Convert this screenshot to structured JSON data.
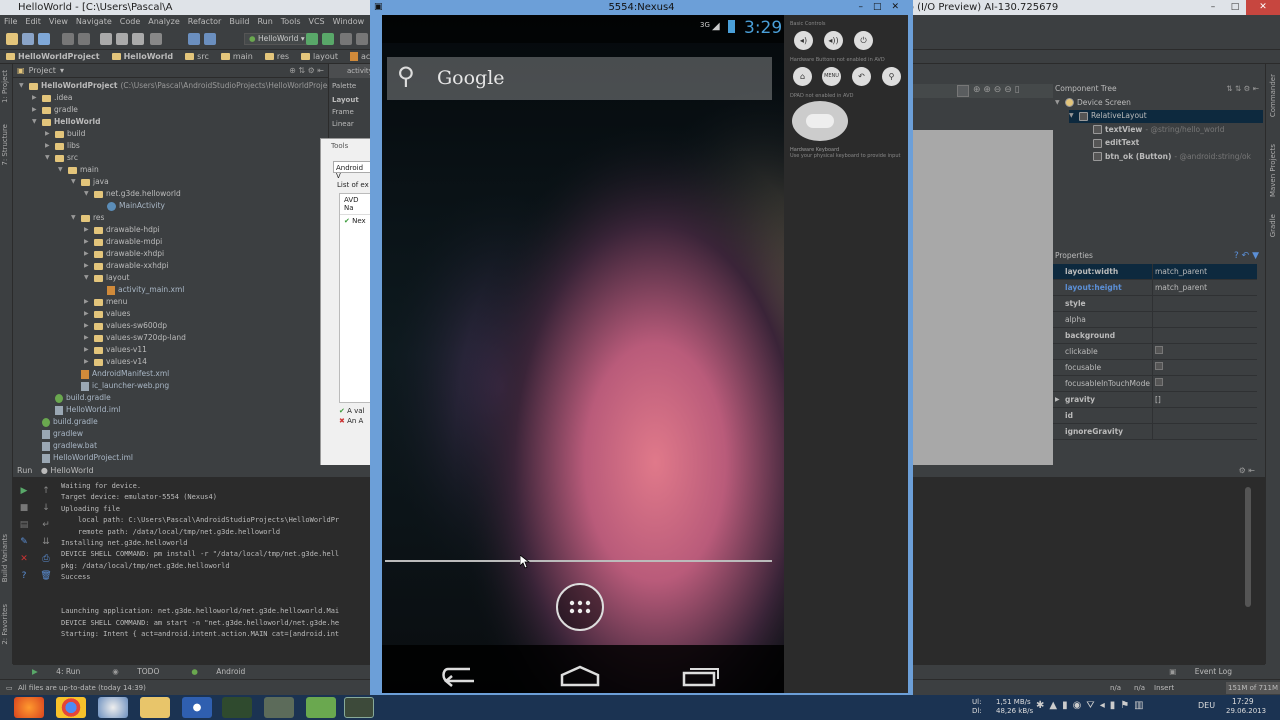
{
  "ide": {
    "title": "HelloWorld - [C:\\Users\\Pascal\\A",
    "title_right": "io (I/O Preview) AI-130.725679",
    "menu": [
      "File",
      "Edit",
      "View",
      "Navigate",
      "Code",
      "Analyze",
      "Refactor",
      "Build",
      "Run",
      "Tools",
      "VCS",
      "Window",
      "Help"
    ],
    "run_config": "HelloWorld",
    "breadcrumbs": [
      "HelloWorldProject",
      "HelloWorld",
      "src",
      "main",
      "res",
      "layout",
      "activity_main.xml"
    ],
    "editor_tab": "activity"
  },
  "project_panel": {
    "header": "Project",
    "tree": [
      {
        "label": "HelloWorldProject",
        "suffix": "(C:\\Users\\Pascal\\AndroidStudioProjects\\HelloWorldProject)",
        "depth": 0,
        "type": "folder",
        "open": true
      },
      {
        "label": ".idea",
        "depth": 1,
        "type": "folder"
      },
      {
        "label": "gradle",
        "depth": 1,
        "type": "folder"
      },
      {
        "label": "HelloWorld",
        "depth": 1,
        "type": "folder",
        "open": true
      },
      {
        "label": "build",
        "depth": 2,
        "type": "folder"
      },
      {
        "label": "libs",
        "depth": 2,
        "type": "folder"
      },
      {
        "label": "src",
        "depth": 2,
        "type": "folder",
        "open": true
      },
      {
        "label": "main",
        "depth": 3,
        "type": "folder",
        "open": true
      },
      {
        "label": "java",
        "depth": 4,
        "type": "folder",
        "open": true
      },
      {
        "label": "net.g3de.helloworld",
        "depth": 5,
        "type": "folder",
        "open": true
      },
      {
        "label": "MainActivity",
        "depth": 6,
        "type": "java"
      },
      {
        "label": "res",
        "depth": 4,
        "type": "folder",
        "open": true
      },
      {
        "label": "drawable-hdpi",
        "depth": 5,
        "type": "folder"
      },
      {
        "label": "drawable-mdpi",
        "depth": 5,
        "type": "folder"
      },
      {
        "label": "drawable-xhdpi",
        "depth": 5,
        "type": "folder"
      },
      {
        "label": "drawable-xxhdpi",
        "depth": 5,
        "type": "folder"
      },
      {
        "label": "layout",
        "depth": 5,
        "type": "folder",
        "open": true
      },
      {
        "label": "activity_main.xml",
        "depth": 6,
        "type": "xml"
      },
      {
        "label": "menu",
        "depth": 5,
        "type": "folder"
      },
      {
        "label": "values",
        "depth": 5,
        "type": "folder"
      },
      {
        "label": "values-sw600dp",
        "depth": 5,
        "type": "folder"
      },
      {
        "label": "values-sw720dp-land",
        "depth": 5,
        "type": "folder"
      },
      {
        "label": "values-v11",
        "depth": 5,
        "type": "folder"
      },
      {
        "label": "values-v14",
        "depth": 5,
        "type": "folder"
      },
      {
        "label": "AndroidManifest.xml",
        "depth": 4,
        "type": "xml"
      },
      {
        "label": "ic_launcher-web.png",
        "depth": 4,
        "type": "file"
      },
      {
        "label": "build.gradle",
        "depth": 2,
        "type": "gradle"
      },
      {
        "label": "HelloWorld.iml",
        "depth": 2,
        "type": "file"
      },
      {
        "label": "build.gradle",
        "depth": 1,
        "type": "gradle"
      },
      {
        "label": "gradlew",
        "depth": 1,
        "type": "file"
      },
      {
        "label": "gradlew.bat",
        "depth": 1,
        "type": "file"
      },
      {
        "label": "HelloWorldProject.iml",
        "depth": 1,
        "type": "file"
      }
    ]
  },
  "palette": {
    "header": "Palette",
    "items": [
      "Layout",
      "Frame",
      "Linear"
    ]
  },
  "avd_dialog": {
    "tools": "Tools",
    "tab": "Android V",
    "list_label": "List of ex",
    "col": "AVD Na",
    "row": "Nex",
    "msg1": "A val",
    "msg2": "An A"
  },
  "emulator": {
    "title": "5554:Nexus4",
    "network": "3G",
    "time": "3:29",
    "search_text": "Google",
    "controls": {
      "basic": "Basic Controls",
      "hardware": "Hardware Buttons",
      "hardware_note": "not enabled in AVD",
      "dpad": "DPAD",
      "dpad_note": "not enabled in AVD",
      "keyboard": "Hardware Keyboard",
      "keyboard_note": "Use your physical keyboard to provide input",
      "menu_label": "MENU"
    }
  },
  "component_tree": {
    "header": "Component Tree",
    "items": [
      {
        "label": "Device Screen",
        "depth": 0
      },
      {
        "label": "RelativeLayout",
        "depth": 1,
        "selected": true
      },
      {
        "label": "textView",
        "hint": "- @string/hello_world",
        "depth": 2
      },
      {
        "label": "editText",
        "hint": "",
        "depth": 2
      },
      {
        "label": "btn_ok (Button)",
        "hint": "- @android:string/ok",
        "depth": 2
      }
    ]
  },
  "properties": {
    "header": "Properties",
    "rows": [
      {
        "name": "layout:width",
        "value": "match_parent",
        "bold": true,
        "selected": true
      },
      {
        "name": "layout:height",
        "value": "match_parent",
        "bold": true,
        "link": true
      },
      {
        "name": "style",
        "value": "",
        "bold": true
      },
      {
        "name": "alpha",
        "value": ""
      },
      {
        "name": "background",
        "value": "",
        "bold": true
      },
      {
        "name": "clickable",
        "value": "",
        "check": true
      },
      {
        "name": "focusable",
        "value": "",
        "check": true
      },
      {
        "name": "focusableInTouchMode",
        "value": "",
        "check": true
      },
      {
        "name": "gravity",
        "value": "[]",
        "bold": true,
        "expand": true
      },
      {
        "name": "id",
        "value": "",
        "bold": true
      },
      {
        "name": "ignoreGravity",
        "value": "",
        "bold": true
      }
    ]
  },
  "run_panel": {
    "header": "Run",
    "config": "HelloWorld",
    "lines": [
      "Waiting for device.",
      "Target device: emulator-5554 (Nexus4)",
      "Uploading file",
      "    local path: C:\\Users\\Pascal\\AndroidStudioProjects\\HelloWorldPr",
      "    remote path: /data/local/tmp/net.g3de.helloworld",
      "Installing net.g3de.helloworld",
      "DEVICE SHELL COMMAND: pm install -r \"/data/local/tmp/net.g3de.hell",
      "pkg: /data/local/tmp/net.g3de.helloworld",
      "Success",
      "",
      "",
      "Launching application: net.g3de.helloworld/net.g3de.helloworld.Mai",
      "DEVICE SHELL COMMAND: am start -n \"net.g3de.helloworld/net.g3de.he",
      "Starting: Intent { act=android.intent.action.MAIN cat=[android.int"
    ]
  },
  "left_strip": {
    "project": "1: Project",
    "structure": "7: Structure",
    "build_variants": "Build Variants",
    "favorites": "2: Favorites"
  },
  "right_strip": {
    "commander": "Commander",
    "maven": "Maven Projects",
    "gradle": "Gradle"
  },
  "bottom_tabs": [
    "4: Run",
    "TODO",
    "Android"
  ],
  "event_log": "Event Log",
  "status": {
    "message": "All files are up-to-date (today 14:39)",
    "na1": "n/a",
    "na2": "n/a",
    "insert": "Insert",
    "memory": "151M of 711M"
  },
  "taskbar": {
    "net_up": "1,51 MB/s",
    "net_down": "48,26 kB/s",
    "ul_label": "Ul:",
    "dl_label": "Dl:",
    "lang": "DEU",
    "time": "17:29",
    "date": "29.06.2013"
  }
}
